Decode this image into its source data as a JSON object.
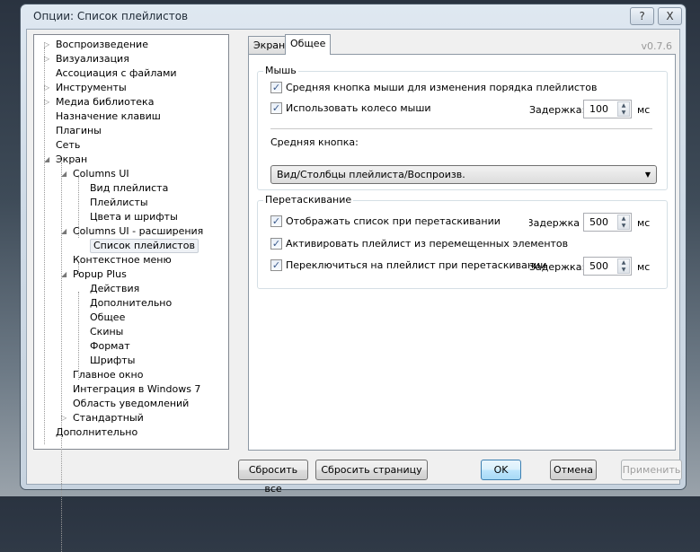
{
  "window": {
    "title": "Опции: Список плейлистов",
    "help": "?",
    "close": "X"
  },
  "tree": [
    {
      "label": "Воспроизведение",
      "level": 0,
      "expander": "collapsed"
    },
    {
      "label": "Визуализация",
      "level": 0,
      "expander": "collapsed"
    },
    {
      "label": "Ассоциация с файлами",
      "level": 0
    },
    {
      "label": "Инструменты",
      "level": 0,
      "expander": "collapsed"
    },
    {
      "label": "Медиа библиотека",
      "level": 0,
      "expander": "collapsed"
    },
    {
      "label": "Назначение клавиш",
      "level": 0
    },
    {
      "label": "Плагины",
      "level": 0
    },
    {
      "label": "Сеть",
      "level": 0
    },
    {
      "label": "Экран",
      "level": 0,
      "expander": "expanded"
    },
    {
      "label": "Columns UI",
      "level": 1,
      "expander": "expanded"
    },
    {
      "label": "Вид плейлиста",
      "level": 2
    },
    {
      "label": "Плейлисты",
      "level": 2
    },
    {
      "label": "Цвета и шрифты",
      "level": 2
    },
    {
      "label": "Columns UI - расширения",
      "level": 1,
      "expander": "expanded"
    },
    {
      "label": "Список плейлистов",
      "level": 2,
      "selected": true
    },
    {
      "label": "Контекстное меню",
      "level": 1
    },
    {
      "label": "Popup Plus",
      "level": 1,
      "expander": "expanded"
    },
    {
      "label": "Действия",
      "level": 2
    },
    {
      "label": "Дополнительно",
      "level": 2
    },
    {
      "label": "Общее",
      "level": 2
    },
    {
      "label": "Скины",
      "level": 2
    },
    {
      "label": "Формат",
      "level": 2
    },
    {
      "label": "Шрифты",
      "level": 2
    },
    {
      "label": "Главное окно",
      "level": 1
    },
    {
      "label": "Интеграция в Windows 7",
      "level": 1
    },
    {
      "label": "Область уведомлений",
      "level": 1
    },
    {
      "label": "Стандартный",
      "level": 1,
      "expander": "collapsed"
    },
    {
      "label": "Дополнительно",
      "level": 0
    }
  ],
  "tabs": [
    {
      "label": "Экран"
    },
    {
      "label": "Общее",
      "active": true
    }
  ],
  "version": "v0.7.6",
  "mouse": {
    "title": "Мышь",
    "middle_reorder": {
      "label": "Средняя кнопка мыши для изменения порядка плейлистов",
      "checked": true
    },
    "wheel": {
      "label": "Использовать колесо мыши",
      "checked": true
    },
    "delay_label": "Задержка:",
    "delay": "100",
    "unit": "мс",
    "middle_label": "Средняя кнопка:",
    "middle_value": "Вид/Столбцы плейлиста/Воспроизв."
  },
  "dnd": {
    "title": "Перетаскивание",
    "show_list": {
      "label": "Отображать список при перетаскивании",
      "checked": true
    },
    "show_delay_label": "Задержка:",
    "show_delay": "500",
    "activate": {
      "label": "Активировать плейлист из перемещенных элементов",
      "checked": true
    },
    "switch": {
      "label": "Переключиться на плейлист при перетаскивании",
      "checked": true
    },
    "switch_delay_label": "Задержка:",
    "switch_delay": "500",
    "unit": "мс"
  },
  "buttons": {
    "reset_all": "Сбросить все",
    "reset_page": "Сбросить страницу",
    "ok": "OK",
    "cancel": "Отмена",
    "apply": "Применить"
  }
}
